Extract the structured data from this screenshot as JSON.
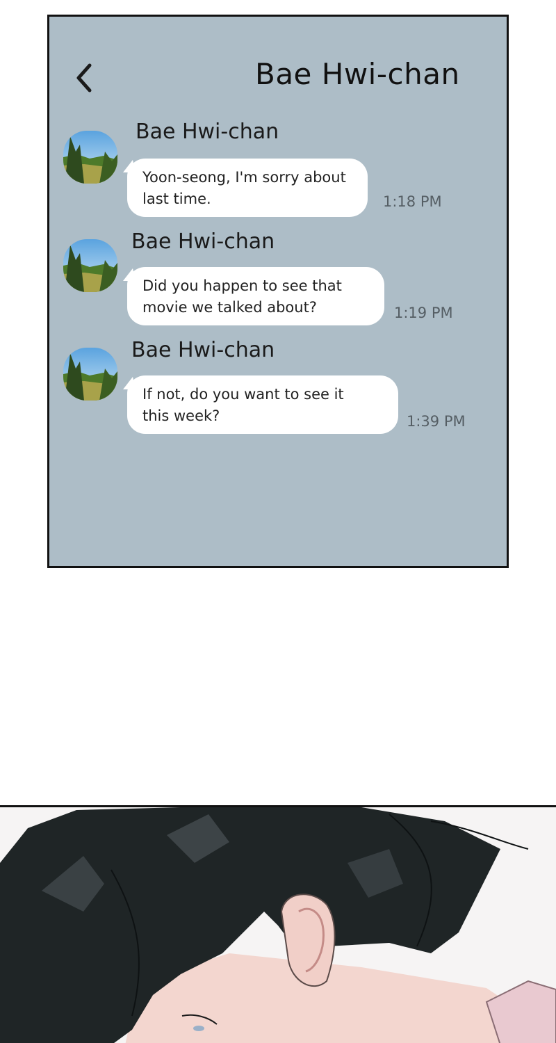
{
  "chat": {
    "title": "Bae Hwi-chan",
    "messages": [
      {
        "sender": "Bae Hwi-chan",
        "line1": "Yoon-seong, I'm sorry about",
        "line2": "last time.",
        "time": "1:18 PM"
      },
      {
        "sender": "Bae Hwi-chan",
        "line1": "Did you happen to see that",
        "line2": "movie we talked about?",
        "time": "1:19 PM"
      },
      {
        "sender": "Bae Hwi-chan",
        "line1": "If not, do you want to see it",
        "line2": "this week?",
        "time": "1:39 PM"
      }
    ]
  },
  "icons": {
    "back": "chevron-left-icon"
  },
  "colors": {
    "chat_background": "#adbdc7",
    "bubble": "#ffffff",
    "hair": "#1f2526",
    "skin": "#f3d6cf"
  }
}
